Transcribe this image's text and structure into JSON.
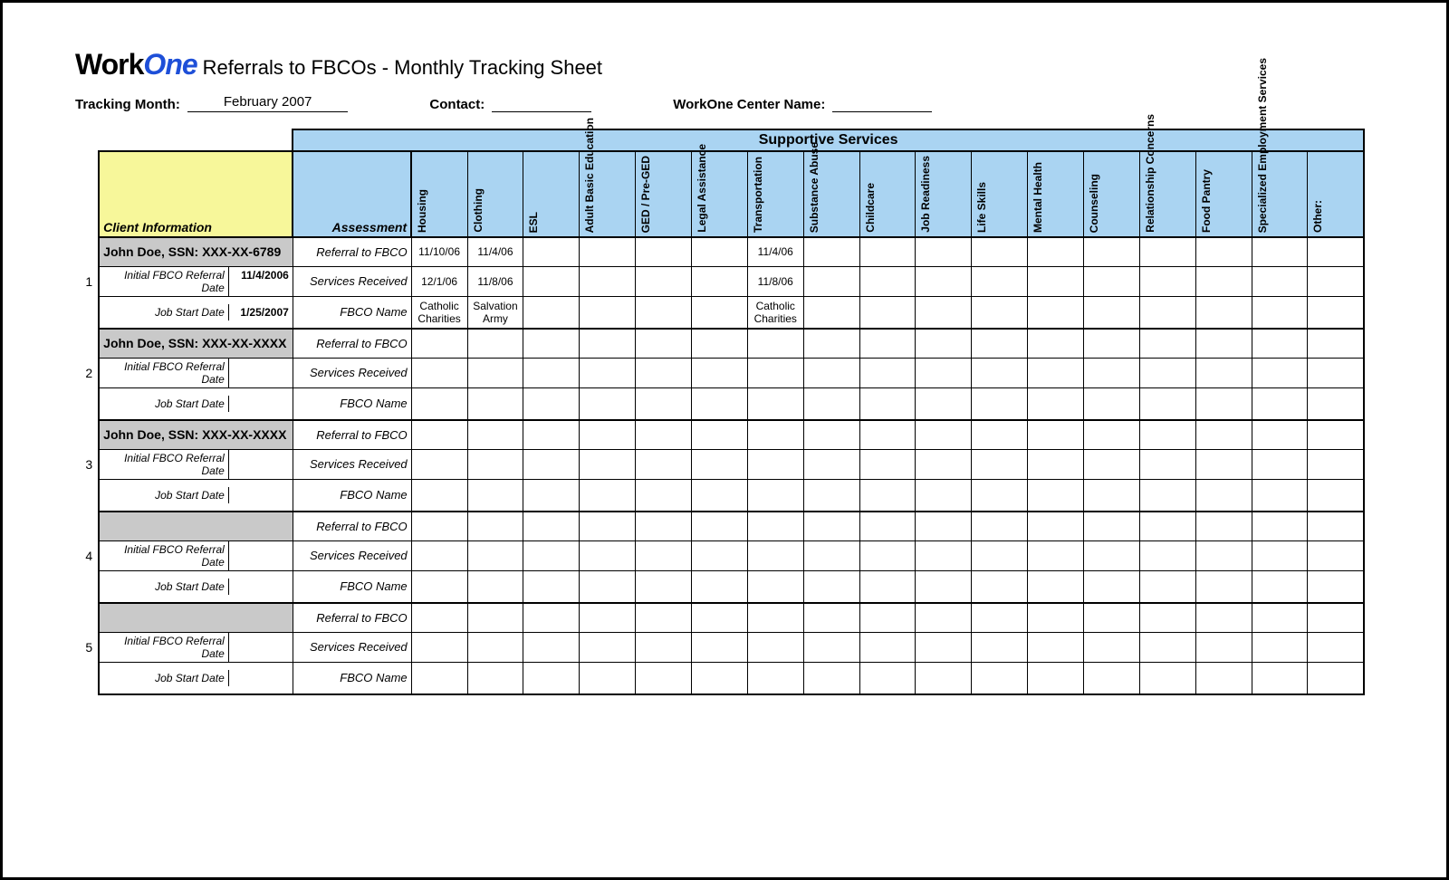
{
  "logo": {
    "part1": "Work",
    "part2": "One"
  },
  "title": "Referrals to FBCOs - Monthly Tracking Sheet",
  "meta": {
    "tracking_label": "Tracking Month:",
    "tracking_value": "February 2007",
    "contact_label": "Contact:",
    "contact_value": "",
    "center_label": "WorkOne Center Name:",
    "center_value": ""
  },
  "headers": {
    "supportive_services": "Supportive Services",
    "client_info": "Client Information",
    "assessment": "Assessment",
    "services": [
      "Housing",
      "Clothing",
      "ESL",
      "Adult Basic Education",
      "GED / Pre-GED",
      "Legal Assistance",
      "Transportation",
      "Substance Abuse",
      "Childcare",
      "Job Readiness",
      "Life Skills",
      "Mental Health",
      "Counseling",
      "Relationship Concerns",
      "Food Pantry",
      "Specialized Employment Services",
      "Other:"
    ]
  },
  "row_labels": {
    "initial": "Initial FBCO Referral Date",
    "jobstart": "Job Start Date",
    "referral": "Referral to FBCO",
    "received": "Services Received",
    "fbconame": "FBCO Name"
  },
  "blocks": [
    {
      "idx": "1",
      "ssn": "John Doe, SSN: XXX-XX-6789",
      "initial_val": "11/4/2006",
      "jobstart_val": "1/25/2007",
      "rows": [
        {
          "cells": [
            "11/10/06",
            "11/4/06",
            "",
            "",
            "",
            "",
            "11/4/06",
            "",
            "",
            "",
            "",
            "",
            "",
            "",
            "",
            "",
            ""
          ]
        },
        {
          "cells": [
            "12/1/06",
            "11/8/06",
            "",
            "",
            "",
            "",
            "11/8/06",
            "",
            "",
            "",
            "",
            "",
            "",
            "",
            "",
            "",
            ""
          ]
        },
        {
          "cells": [
            "Catholic Charities",
            "Salvation Army",
            "",
            "",
            "",
            "",
            "Catholic Charities",
            "",
            "",
            "",
            "",
            "",
            "",
            "",
            "",
            "",
            ""
          ]
        }
      ]
    },
    {
      "idx": "2",
      "ssn": "John Doe, SSN: XXX-XX-XXXX",
      "initial_val": "",
      "jobstart_val": "",
      "rows": [
        {
          "cells": [
            "",
            "",
            "",
            "",
            "",
            "",
            "",
            "",
            "",
            "",
            "",
            "",
            "",
            "",
            "",
            "",
            ""
          ]
        },
        {
          "cells": [
            "",
            "",
            "",
            "",
            "",
            "",
            "",
            "",
            "",
            "",
            "",
            "",
            "",
            "",
            "",
            "",
            ""
          ]
        },
        {
          "cells": [
            "",
            "",
            "",
            "",
            "",
            "",
            "",
            "",
            "",
            "",
            "",
            "",
            "",
            "",
            "",
            "",
            ""
          ]
        }
      ]
    },
    {
      "idx": "3",
      "ssn": "John Doe, SSN: XXX-XX-XXXX",
      "initial_val": "",
      "jobstart_val": "",
      "rows": [
        {
          "cells": [
            "",
            "",
            "",
            "",
            "",
            "",
            "",
            "",
            "",
            "",
            "",
            "",
            "",
            "",
            "",
            "",
            ""
          ]
        },
        {
          "cells": [
            "",
            "",
            "",
            "",
            "",
            "",
            "",
            "",
            "",
            "",
            "",
            "",
            "",
            "",
            "",
            "",
            ""
          ]
        },
        {
          "cells": [
            "",
            "",
            "",
            "",
            "",
            "",
            "",
            "",
            "",
            "",
            "",
            "",
            "",
            "",
            "",
            "",
            ""
          ]
        }
      ]
    },
    {
      "idx": "4",
      "ssn": "",
      "initial_val": "",
      "jobstart_val": "",
      "rows": [
        {
          "cells": [
            "",
            "",
            "",
            "",
            "",
            "",
            "",
            "",
            "",
            "",
            "",
            "",
            "",
            "",
            "",
            "",
            ""
          ]
        },
        {
          "cells": [
            "",
            "",
            "",
            "",
            "",
            "",
            "",
            "",
            "",
            "",
            "",
            "",
            "",
            "",
            "",
            "",
            ""
          ]
        },
        {
          "cells": [
            "",
            "",
            "",
            "",
            "",
            "",
            "",
            "",
            "",
            "",
            "",
            "",
            "",
            "",
            "",
            "",
            ""
          ]
        }
      ]
    },
    {
      "idx": "5",
      "ssn": "",
      "initial_val": "",
      "jobstart_val": "",
      "rows": [
        {
          "cells": [
            "",
            "",
            "",
            "",
            "",
            "",
            "",
            "",
            "",
            "",
            "",
            "",
            "",
            "",
            "",
            "",
            ""
          ]
        },
        {
          "cells": [
            "",
            "",
            "",
            "",
            "",
            "",
            "",
            "",
            "",
            "",
            "",
            "",
            "",
            "",
            "",
            "",
            ""
          ]
        },
        {
          "cells": [
            "",
            "",
            "",
            "",
            "",
            "",
            "",
            "",
            "",
            "",
            "",
            "",
            "",
            "",
            "",
            "",
            ""
          ]
        }
      ]
    }
  ]
}
